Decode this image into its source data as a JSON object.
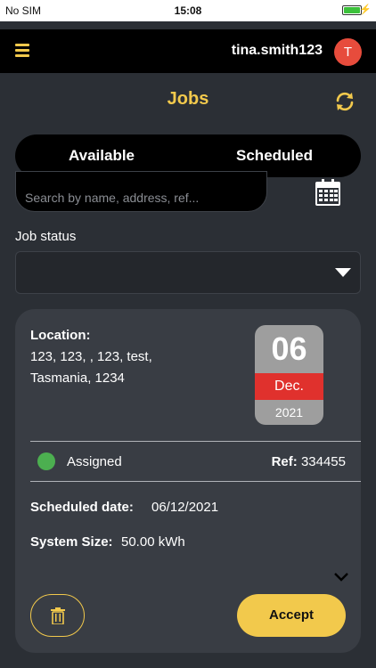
{
  "status_bar": {
    "carrier": "No SIM",
    "time": "15:08",
    "battery_percent": 100
  },
  "header": {
    "username": "tina.smith123",
    "avatar_initial": "T"
  },
  "page": {
    "title": "Jobs"
  },
  "tabs": [
    {
      "label": "Available",
      "active": true
    },
    {
      "label": "Scheduled",
      "active": false
    }
  ],
  "search": {
    "placeholder": "Search by name, address, ref...",
    "value": ""
  },
  "filter": {
    "label": "Job status",
    "selected": ""
  },
  "job": {
    "location_label": "Location:",
    "address_line1": "123, 123, , 123, test,",
    "address_line2": "Tasmania, 1234",
    "date": {
      "day": "06",
      "month": "Dec.",
      "year": "2021"
    },
    "status": "Assigned",
    "ref_label": "Ref:",
    "ref_value": "334455",
    "scheduled_label": "Scheduled date:",
    "scheduled_value": "06/12/2021",
    "size_label": "System Size:",
    "size_value": "50.00 kWh",
    "accept_label": "Accept"
  },
  "colors": {
    "background": "#2b2f35",
    "accent": "#f2c94c",
    "tab_indicator": "#e74c3c",
    "status_assigned": "#4caf50",
    "date_month_bg": "#e0312d"
  },
  "icons": [
    "menu-icon",
    "refresh-icon",
    "calendar-icon",
    "chevron-down-icon",
    "trash-icon"
  ]
}
